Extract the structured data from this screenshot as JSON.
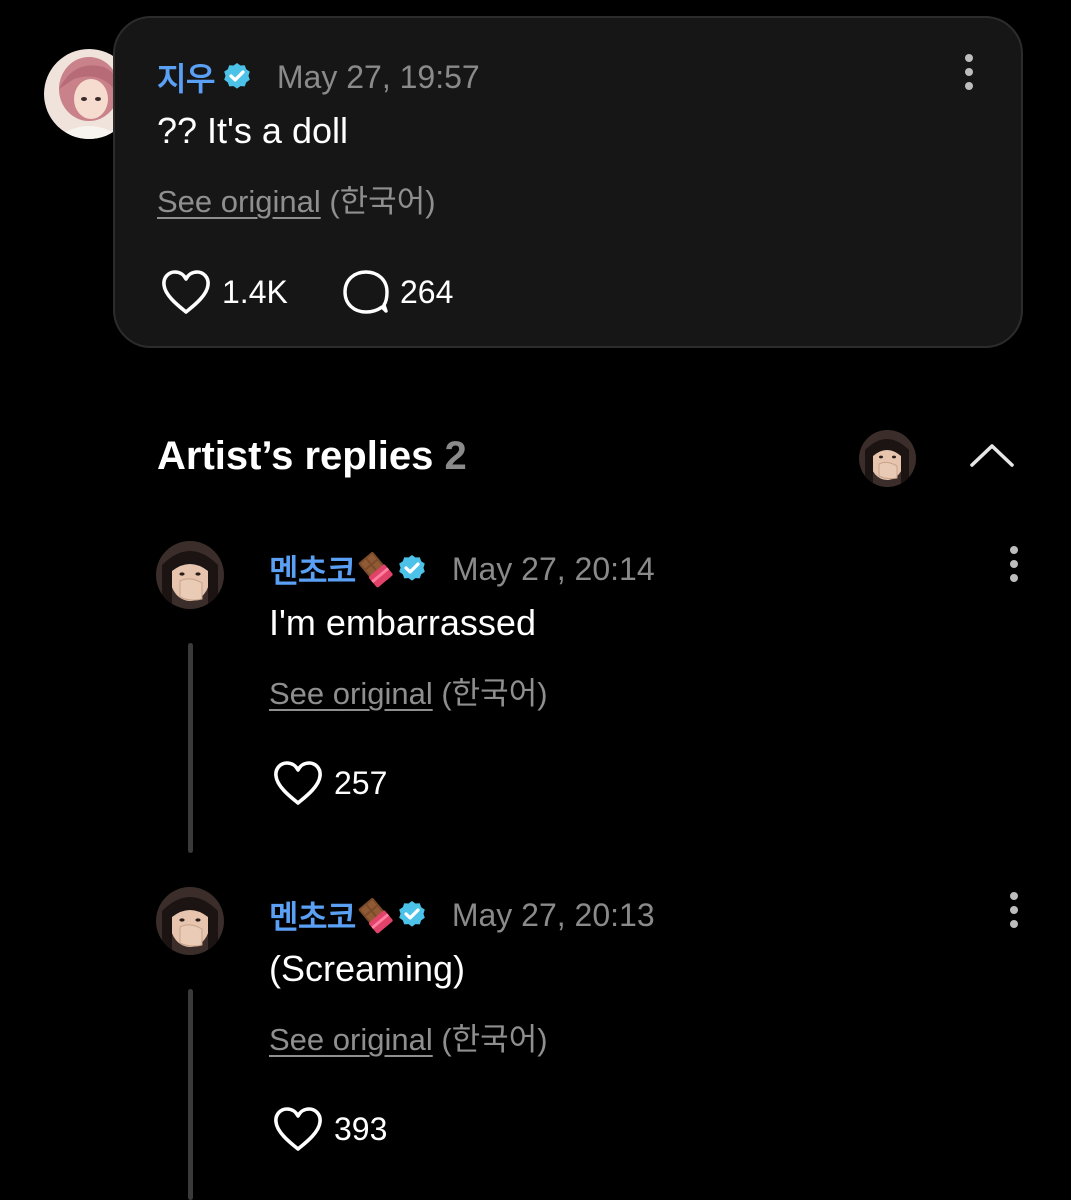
{
  "post": {
    "author": "지우",
    "timestamp": "May 27, 19:57",
    "text": "?? It's a doll",
    "see_original": "See original",
    "language": "(한국어)",
    "likes": "1.4K",
    "comments": "264"
  },
  "replies_section": {
    "title": "Artist’s replies",
    "count": "2"
  },
  "replies": [
    {
      "author": "멘초코",
      "timestamp": "May 27, 20:14",
      "text": "I'm embarrassed",
      "see_original": "See original",
      "language": "(한국어)",
      "likes": "257"
    },
    {
      "author": "멘초코",
      "timestamp": "May 27, 20:13",
      "text": "(Screaming)",
      "see_original": "See original",
      "language": "(한국어)",
      "likes": "393"
    }
  ],
  "colors": {
    "background": "#000000",
    "card": "#161616",
    "author_blue": "#5aa0f5",
    "verified": "#4dc2e8",
    "muted": "#8a8a8a"
  },
  "icons": {
    "verified": "verified-badge-icon",
    "like": "heart-icon",
    "comment": "comment-bubble-icon",
    "more": "more-vertical-icon",
    "collapse": "chevron-up-icon",
    "emoji": "chocolate-emoji-icon"
  }
}
